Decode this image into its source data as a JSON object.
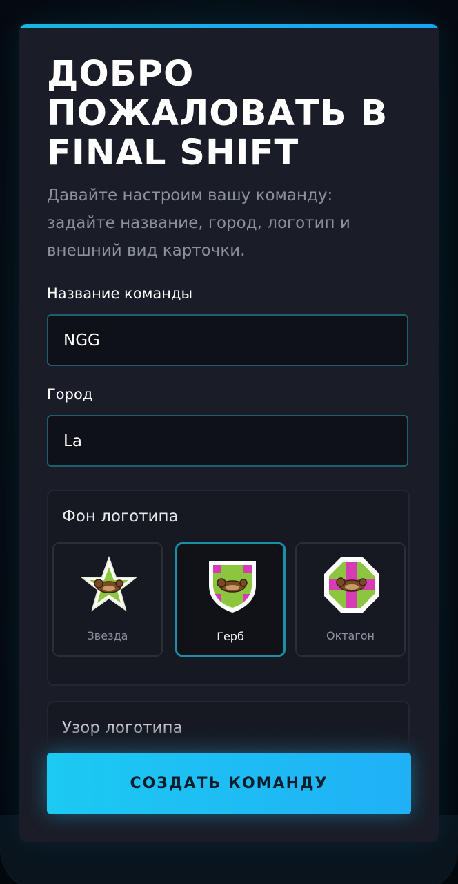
{
  "header": {
    "title": "ДОБРО ПОЖАЛОВАТЬ В FINAL SHIFT",
    "subtitle": "Давайте настроим вашу команду: задайте название, город, логотип и внешний вид карточки."
  },
  "form": {
    "team_name": {
      "label": "Название команды",
      "value": "NGG"
    },
    "city": {
      "label": "Город",
      "value": "La"
    }
  },
  "logo_background": {
    "title": "Фон логотипа",
    "selected": "Герб",
    "options": [
      {
        "label": "Звезда",
        "icon": "star-logo-icon"
      },
      {
        "label": "Герб",
        "icon": "shield-logo-icon"
      },
      {
        "label": "Октагон",
        "icon": "octagon-logo-icon"
      }
    ]
  },
  "logo_pattern": {
    "title": "Узор логотипа"
  },
  "submit": {
    "label": "СОЗДАТЬ КОМАНДУ"
  },
  "colors": {
    "accent": "#1ccaf2",
    "card_bg": "#1a1d27",
    "input_border": "#1d5f6a",
    "logo_green": "#8cc63f",
    "logo_magenta": "#d63db5"
  }
}
